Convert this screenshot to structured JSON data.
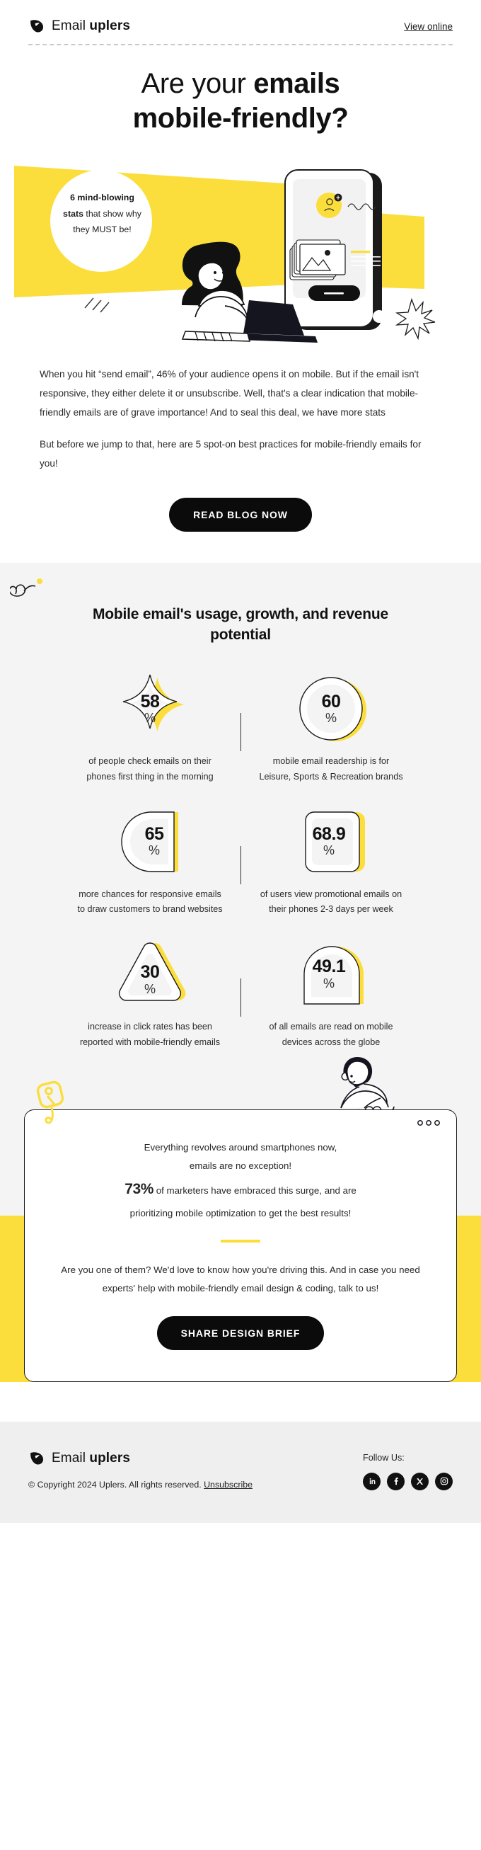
{
  "header": {
    "brand_prefix": "Email ",
    "brand_bold": "uplers",
    "view_online": "View online",
    "logo_icon": "uplers-pick-logo-icon"
  },
  "hero": {
    "headline_line1_light": "Are your ",
    "headline_line1_bold": "emails",
    "headline_line2_bold": "mobile-friendly?",
    "badge_bold_1": "6 mind-blowing",
    "badge_bold_2": "stats",
    "badge_rest": " that show why",
    "badge_line3": "they MUST be!"
  },
  "intro": {
    "paragraph_1": "When you hit “send email”, 46% of your audience opens it on mobile. But if the email isn't responsive, they either delete it or unsubscribe. Well, that's a clear indication that mobile-friendly emails are of grave importance! And to seal this deal, we have more stats",
    "paragraph_2": "But before we jump to that, here are 5 spot-on best practices for mobile-friendly emails for you!",
    "cta_label": "READ BLOG NOW"
  },
  "stats": {
    "title": "Mobile email's usage, growth, and revenue potential",
    "percent_symbol": "%",
    "items": [
      {
        "value": "58",
        "unit": "%",
        "shape": "four-point-star",
        "caption": "of people check emails on their phones first thing in the morning"
      },
      {
        "value": "60",
        "unit": "%",
        "shape": "circle",
        "caption": "mobile email readership is for Leisure, Sports & Recreation brands"
      },
      {
        "value": "65",
        "unit": "%",
        "shape": "d-shape",
        "caption": "more chances for responsive emails to draw customers to brand websites"
      },
      {
        "value": "68.9",
        "unit": "%",
        "shape": "rounded-square",
        "caption": "of users view promotional emails on their phones 2-3 days per week"
      },
      {
        "value": "30",
        "unit": "%",
        "shape": "triangle",
        "caption": "increase in click rates has been reported with mobile-friendly emails"
      },
      {
        "value": "49.1",
        "unit": "%",
        "shape": "arch",
        "caption": "of all emails are read on mobile devices across the globe"
      }
    ]
  },
  "promo": {
    "line_1": "Everything revolves around smartphones now,",
    "line_2": "emails are no exception!",
    "stat_big": "73%",
    "line_3": " of marketers have embraced this surge, and are",
    "line_4": "prioritizing mobile optimization to get the best results!",
    "closing": "Are you one of them? We'd love to know how you're driving this. And in case you need experts' help with mobile-friendly email design & coding, talk to us!",
    "cta_label": "SHARE DESIGN BRIEF"
  },
  "footer": {
    "brand_prefix": "Email ",
    "brand_bold": "uplers",
    "copyright": "© Copyright 2024 Uplers. All rights reserved. ",
    "unsubscribe": "Unsubscribe",
    "follow_label": "Follow Us:",
    "socials": [
      {
        "name": "linkedin-icon",
        "glyph": "in"
      },
      {
        "name": "facebook-icon",
        "glyph": "f"
      },
      {
        "name": "x-twitter-icon",
        "glyph": "X"
      },
      {
        "name": "instagram-icon",
        "glyph": "ig"
      }
    ]
  },
  "colors": {
    "yellow": "#FBDE3B",
    "dark": "#0b0b0b",
    "grey_bg": "#f4f4f4",
    "footer_bg": "#efefef"
  }
}
